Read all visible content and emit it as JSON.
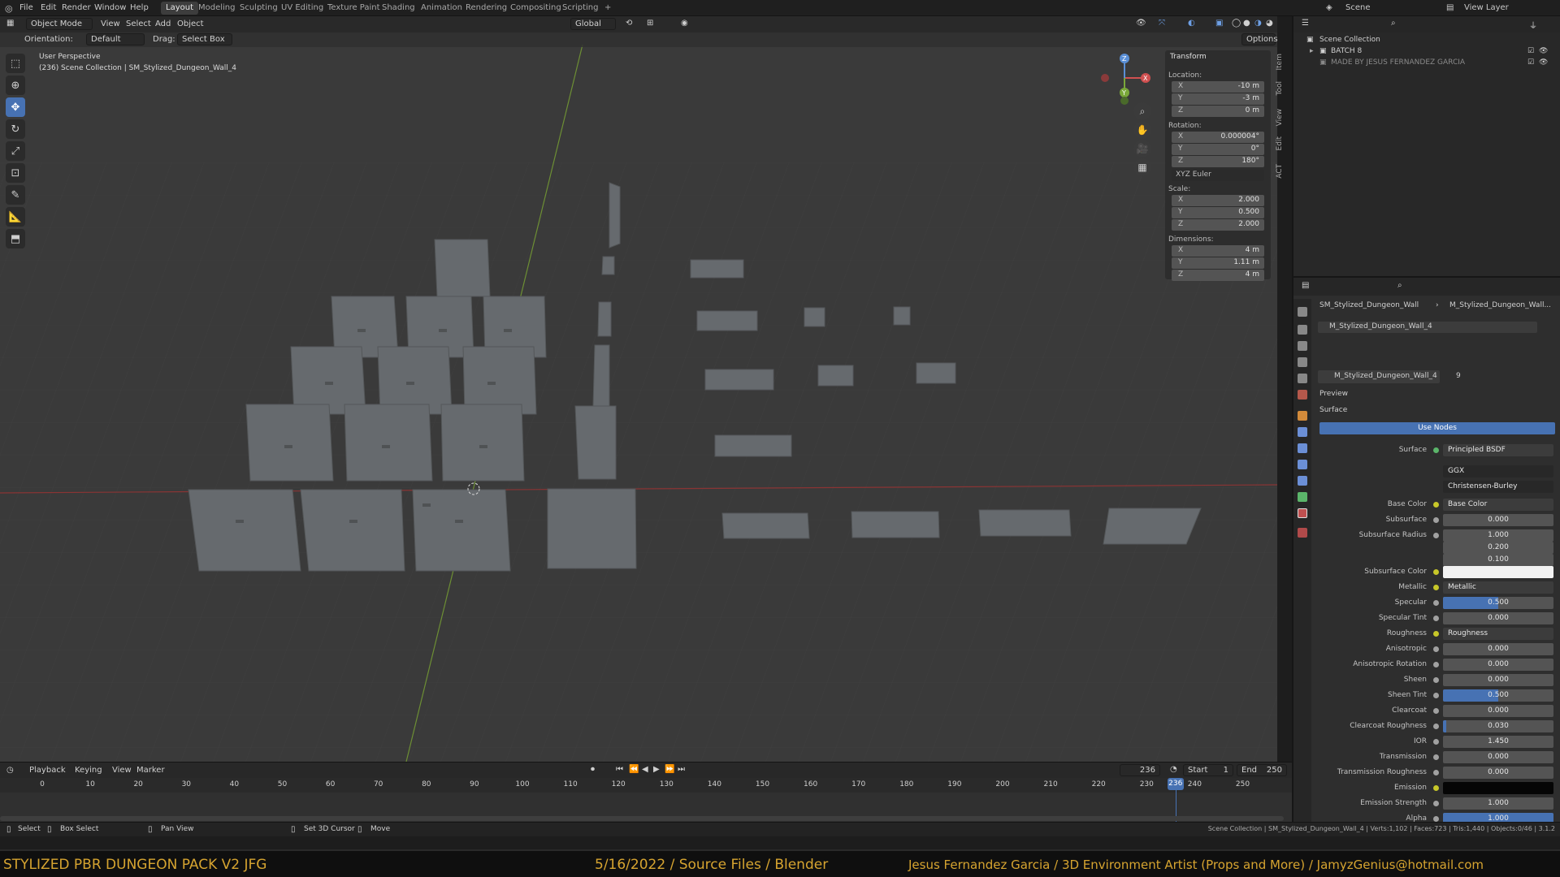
{
  "menu": [
    "File",
    "Edit",
    "Render",
    "Window",
    "Help"
  ],
  "workspaces": [
    "Layout",
    "Modeling",
    "Sculpting",
    "UV Editing",
    "Texture Paint",
    "Shading",
    "Animation",
    "Rendering",
    "Compositing",
    "Scripting",
    "+"
  ],
  "active_workspace": "Layout",
  "scene": {
    "label": "Scene",
    "view_layer": "View Layer"
  },
  "viewport_header": {
    "mode": "Object Mode",
    "menus": [
      "View",
      "Select",
      "Add",
      "Object"
    ],
    "transform_orientation": "Global",
    "orientation_label": "Orientation:",
    "orientation_value": "Default",
    "drag_label": "Drag:",
    "drag_value": "Select Box",
    "options": "Options"
  },
  "viewport_info": {
    "perspective": "User Perspective",
    "collection": "(236) Scene Collection | SM_Stylized_Dungeon_Wall_4"
  },
  "transform_panel": {
    "title": "Transform",
    "location_label": "Location:",
    "location": {
      "x": "-10 m",
      "y": "-3 m",
      "z": "0 m"
    },
    "rotation_label": "Rotation:",
    "rotation": {
      "x": "0.000004°",
      "y": "0°",
      "z": "180°"
    },
    "rotation_mode": "XYZ Euler",
    "scale_label": "Scale:",
    "scale": {
      "x": "2.000",
      "y": "0.500",
      "z": "2.000"
    },
    "dimensions_label": "Dimensions:",
    "dimensions": {
      "x": "4 m",
      "y": "1.11 m",
      "z": "4 m"
    }
  },
  "side_tabs": [
    "Item",
    "Tool",
    "View",
    "Edit",
    "ACT"
  ],
  "outliner": {
    "root": "Scene Collection",
    "items": [
      "BATCH 8",
      "MADE BY JESUS FERNANDEZ GARCIA"
    ]
  },
  "properties": {
    "breadcrumb_object": "SM_Stylized_Dungeon_Wall",
    "breadcrumb_material": "M_Stylized_Dungeon_Wall...",
    "slot": "M_Stylized_Dungeon_Wall_4",
    "material_name": "M_Stylized_Dungeon_Wall_4",
    "users": "9",
    "preview": "Preview",
    "surface_section": "Surface",
    "use_nodes": "Use Nodes",
    "surface_label": "Surface",
    "surface_value": "Principled BSDF",
    "distribution": "GGX",
    "subsurface_method": "Christensen-Burley",
    "rows": [
      {
        "label": "Base Color",
        "value": "Base Color",
        "kind": "link"
      },
      {
        "label": "Subsurface",
        "value": "0.000",
        "kind": "num",
        "fill": 0
      },
      {
        "label": "Subsurface Radius",
        "value": "1.000",
        "kind": "num",
        "fill": 0
      },
      {
        "label": "",
        "value": "0.200",
        "kind": "num",
        "fill": 0
      },
      {
        "label": "",
        "value": "0.100",
        "kind": "num",
        "fill": 0
      },
      {
        "label": "Subsurface Color",
        "value": "",
        "kind": "color",
        "color": "#f2f2f2"
      },
      {
        "label": "Metallic",
        "value": "Metallic",
        "kind": "link"
      },
      {
        "label": "Specular",
        "value": "0.500",
        "kind": "num",
        "fill": 0.5
      },
      {
        "label": "Specular Tint",
        "value": "0.000",
        "kind": "num",
        "fill": 0
      },
      {
        "label": "Roughness",
        "value": "Roughness",
        "kind": "link"
      },
      {
        "label": "Anisotropic",
        "value": "0.000",
        "kind": "num",
        "fill": 0
      },
      {
        "label": "Anisotropic Rotation",
        "value": "0.000",
        "kind": "num",
        "fill": 0
      },
      {
        "label": "Sheen",
        "value": "0.000",
        "kind": "num",
        "fill": 0
      },
      {
        "label": "Sheen Tint",
        "value": "0.500",
        "kind": "num",
        "fill": 0.5
      },
      {
        "label": "Clearcoat",
        "value": "0.000",
        "kind": "num",
        "fill": 0
      },
      {
        "label": "Clearcoat Roughness",
        "value": "0.030",
        "kind": "num",
        "fill": 0.03
      },
      {
        "label": "IOR",
        "value": "1.450",
        "kind": "num",
        "fill": 0
      },
      {
        "label": "Transmission",
        "value": "0.000",
        "kind": "num",
        "fill": 0
      },
      {
        "label": "Transmission Roughness",
        "value": "0.000",
        "kind": "num",
        "fill": 0
      },
      {
        "label": "Emission",
        "value": "",
        "kind": "color",
        "color": "#050505"
      },
      {
        "label": "Emission Strength",
        "value": "1.000",
        "kind": "num",
        "fill": 0
      },
      {
        "label": "Alpha",
        "value": "1.000",
        "kind": "num",
        "fill": 1
      }
    ]
  },
  "timeline": {
    "menus": [
      "Playback",
      "Keying",
      "View",
      "Marker"
    ],
    "current_frame": "236",
    "start_label": "Start",
    "start": "1",
    "end_label": "End",
    "end": "250",
    "ticks": [
      "0",
      "10",
      "20",
      "30",
      "40",
      "50",
      "60",
      "70",
      "80",
      "90",
      "100",
      "110",
      "120",
      "130",
      "140",
      "150",
      "160",
      "170",
      "180",
      "190",
      "200",
      "210",
      "220",
      "230",
      "240",
      "250"
    ]
  },
  "statusbar": {
    "hints": [
      "Select",
      "Box Select",
      "Pan View",
      "Set 3D Cursor",
      "Move"
    ],
    "info": "Scene Collection | SM_Stylized_Dungeon_Wall_4 | Verts:1,102 | Faces:723 | Tris:1,440 | Objects:0/46 | 3.1.2"
  },
  "banner": {
    "title": "STYLIZED PBR DUNGEON PACK V2 JFG",
    "center": "5/16/2022 / Source Files / Blender",
    "right": "Jesus Fernandez Garcia / 3D Environment Artist (Props and More) / JamyzGenius@hotmail.com"
  },
  "colors": {
    "accent": "#4772b3",
    "banner_text": "#d6a430",
    "axis_x": "#c0392b",
    "axis_y": "#7aa83a"
  }
}
